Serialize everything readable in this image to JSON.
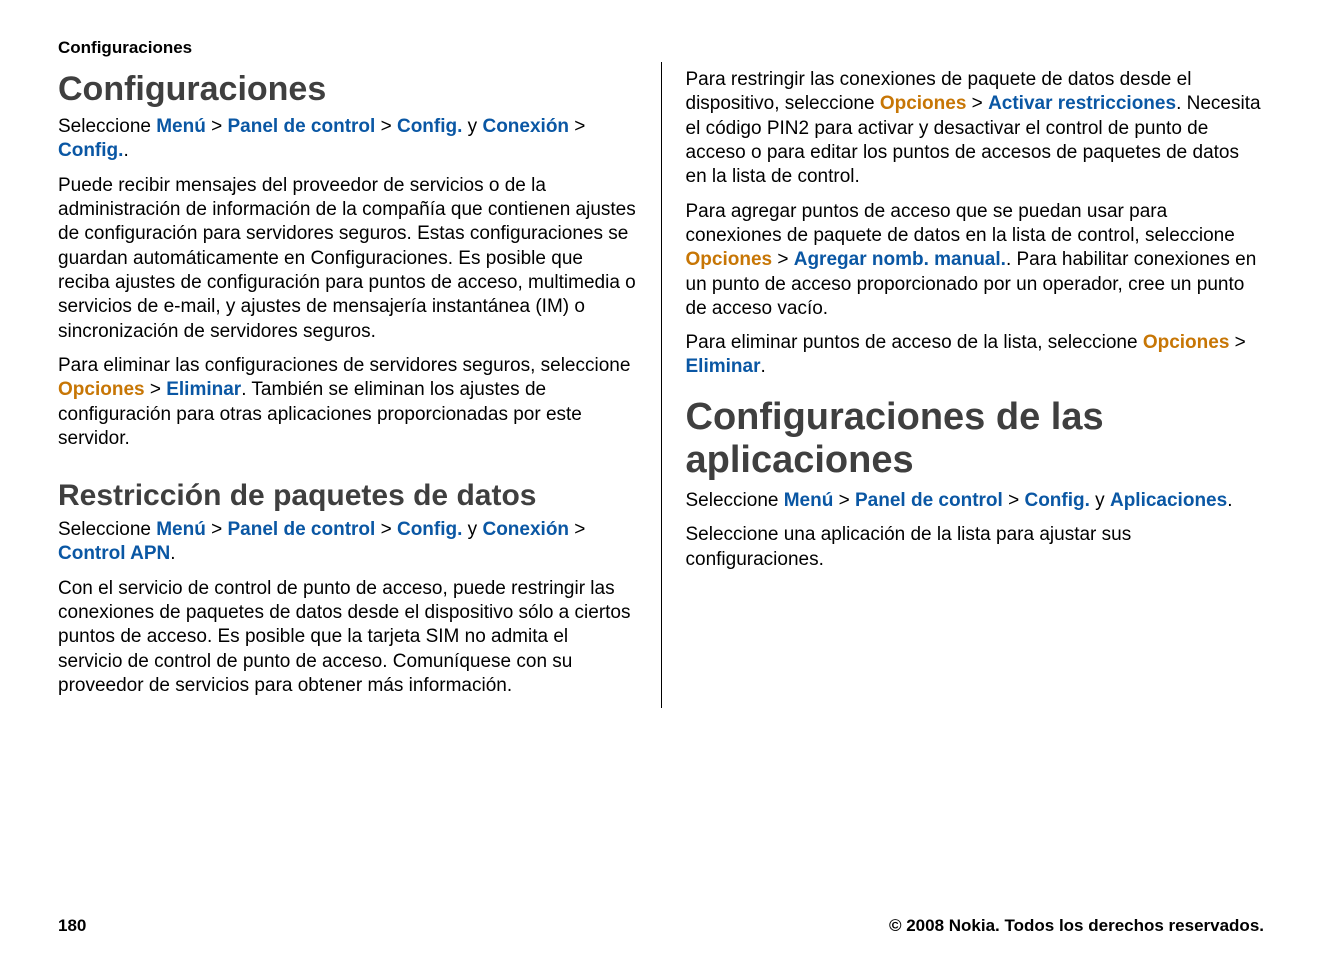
{
  "header": "Configuraciones",
  "left": {
    "h1": "Configuraciones",
    "p1_a": "Seleccione ",
    "p1_menu": "Menú",
    "p1_gt1": " > ",
    "p1_panel": "Panel de control",
    "p1_gt2": " > ",
    "p1_config": "Config.",
    "p1_y": " y ",
    "p1_conexion": "Conexión",
    "p1_gt3": " > ",
    "p1_config2": "Config.",
    "p1_dot": ".",
    "p2": "Puede recibir mensajes del proveedor de servicios o de la administración de información de la compañía que contienen ajustes de configuración para servidores seguros. Estas configuraciones se guardan automáticamente en Configuraciones. Es posible que reciba ajustes de configuración para puntos de acceso, multimedia o servicios de e-mail, y ajustes de mensajería instantánea (IM) o sincronización de servidores seguros.",
    "p3_a": "Para eliminar las configuraciones de servidores seguros, seleccione ",
    "p3_opciones": "Opciones",
    "p3_gt": " > ",
    "p3_eliminar": "Eliminar",
    "p3_b": ". También se eliminan los ajustes de configuración para otras aplicaciones proporcionadas por este servidor.",
    "h2": "Restricción de paquetes de datos",
    "p4_a": "Seleccione ",
    "p4_menu": "Menú",
    "p4_gt1": " > ",
    "p4_panel": "Panel de control",
    "p4_gt2": " > ",
    "p4_config": "Config.",
    "p4_y": " y ",
    "p4_conexion": "Conexión",
    "p4_gt3": " > ",
    "p4_apn": "Control APN",
    "p4_dot": ".",
    "p5": "Con el servicio de control de punto de acceso, puede restringir las conexiones de paquetes de datos desde el dispositivo sólo a ciertos puntos de acceso. Es posible que la tarjeta SIM no admita el servicio de control de punto de acceso. Comuníquese con su proveedor de servicios para obtener más información."
  },
  "right": {
    "p1_a": "Para restringir las conexiones de paquete de datos desde el dispositivo, seleccione ",
    "p1_opciones": "Opciones",
    "p1_gt": " > ",
    "p1_activar": "Activar restricciones",
    "p1_b": ". Necesita el código PIN2 para activar y desactivar el control de punto de acceso o para editar los puntos de accesos de paquetes de datos en la lista de control.",
    "p2_a": "Para agregar puntos de acceso que se puedan usar para conexiones de paquete de datos en la lista de control, seleccione ",
    "p2_opciones": "Opciones",
    "p2_gt": " > ",
    "p2_agregar": "Agregar nomb. manual.",
    "p2_b": ". Para habilitar conexiones en un punto de acceso proporcionado por un operador, cree un punto de acceso vacío.",
    "p3_a": "Para eliminar puntos de acceso de la lista, seleccione ",
    "p3_opciones": "Opciones",
    "p3_gt": " > ",
    "p3_eliminar": "Eliminar",
    "p3_dot": ".",
    "h1": "Configuraciones de las aplicaciones",
    "p4_a": "Seleccione ",
    "p4_menu": "Menú",
    "p4_gt1": " > ",
    "p4_panel": "Panel de control",
    "p4_gt2": " > ",
    "p4_config": "Config.",
    "p4_y": " y ",
    "p4_aplic": "Aplicaciones",
    "p4_dot": ".",
    "p5": "Seleccione una aplicación de la lista para ajustar sus configuraciones."
  },
  "footer": {
    "page_number": "180",
    "copyright": "© 2008 Nokia. Todos los derechos reservados."
  }
}
